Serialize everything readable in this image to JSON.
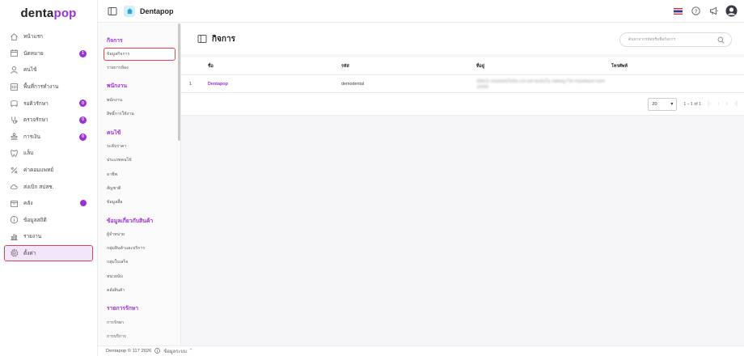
{
  "brand": {
    "part1": "denta",
    "part2": "pop"
  },
  "sidebar": {
    "items": [
      {
        "label": "หน้าแรก",
        "icon": "home-icon"
      },
      {
        "label": "นัดหมาย",
        "icon": "calendar-icon",
        "badge": "1"
      },
      {
        "label": "คนไข้",
        "icon": "user-icon"
      },
      {
        "label": "พื้นที่การทำงาน",
        "icon": "workspace-icon"
      },
      {
        "label": "รอคิวรักษา",
        "icon": "chair-icon",
        "badge": "0"
      },
      {
        "label": "ตรวจรักษา",
        "icon": "stethoscope-icon",
        "badge": "0"
      },
      {
        "label": "การเงิน",
        "icon": "money-icon",
        "badge": "0"
      },
      {
        "label": "แล็บ",
        "icon": "tooth-icon"
      },
      {
        "label": "ค่าคอมแพทย์",
        "icon": "percent-icon"
      },
      {
        "label": "ส่งเบิก สปสช.",
        "icon": "cloud-icon"
      },
      {
        "label": "คลัง",
        "icon": "box-icon",
        "dot": true
      },
      {
        "label": "ข้อมูลสถิติ",
        "icon": "info-icon"
      },
      {
        "label": "รายงาน",
        "icon": "report-icon"
      },
      {
        "label": "ตั้งค่า",
        "icon": "gear-icon"
      }
    ]
  },
  "header": {
    "clinic_name": "Dentapop"
  },
  "submenu": {
    "groups": [
      {
        "title": "กิจการ",
        "items": [
          "ข้อมูลกิจการ",
          "รายการห้อง"
        ]
      },
      {
        "title": "พนักงาน",
        "items": [
          "พนักงาน",
          "สิทธิ์การใช้งาน"
        ]
      },
      {
        "title": "คนไข้",
        "items": [
          "ระดับราคา",
          "ประเภทคนไข้",
          "อาชีพ",
          "สัญชาติ",
          "ข้อมูลสื่อ"
        ]
      },
      {
        "title": "ข้อมูลเกี่ยวกับสินค้า",
        "items": [
          "ผู้จำหน่าย",
          "กลุ่มสินค้าและบริการ",
          "กลุ่มใบเสร็จ",
          "หน่วยนับ",
          "คลังสินค้า"
        ]
      },
      {
        "title": "รายการรักษา",
        "items": [
          "การรักษา",
          "การบริการ"
        ]
      }
    ]
  },
  "footer": {
    "copyright": "Dentapop © 117 2026",
    "status": "ข้อมูลระบบ"
  },
  "main": {
    "title": "กิจการ",
    "search_placeholder": "ค้นหาจากรหัสหรือชื่อกิจการ",
    "table": {
      "columns": [
        "ชื่อ",
        "รหัส",
        "ที่อยู่",
        "โทรศัพท์"
      ],
      "rows": [
        {
          "index": "1",
          "name": "Dentapop",
          "code": "demodental",
          "address": "299/22 ถนนพหลโยธิน แขวงสามเสนใน เขตพญาไท กรุงเทพมหานคร 10400",
          "phone": ""
        }
      ]
    },
    "pagination": {
      "per_page": "20",
      "range": "1 – 1 of 1"
    }
  },
  "colors": {
    "accent": "#9b30d9",
    "highlight_border": "#e0434f"
  }
}
